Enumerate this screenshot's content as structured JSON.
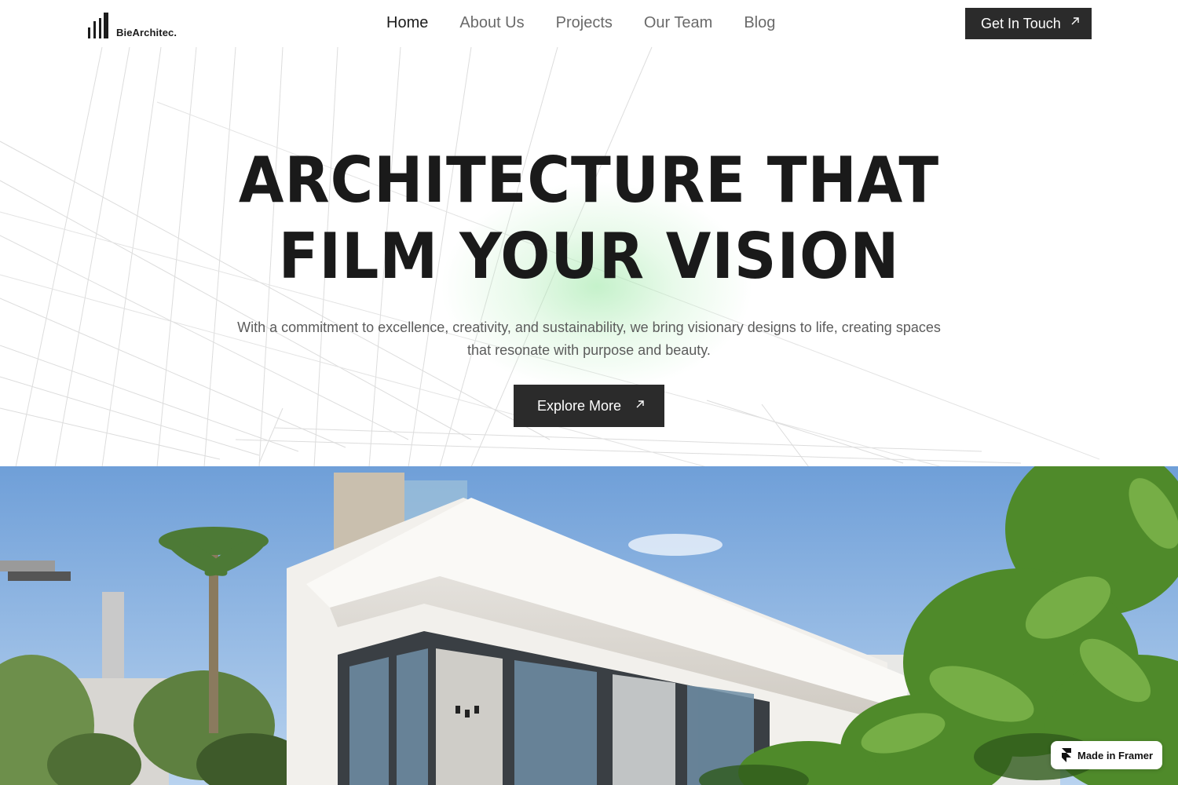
{
  "brand": {
    "name": "BieArchitec."
  },
  "nav": {
    "items": [
      {
        "label": "Home",
        "active": true
      },
      {
        "label": "About Us",
        "active": false
      },
      {
        "label": "Projects",
        "active": false
      },
      {
        "label": "Our Team",
        "active": false
      },
      {
        "label": "Blog",
        "active": false
      }
    ],
    "cta_label": "Get In Touch"
  },
  "hero": {
    "headline_line1": "ARCHITECTURE THAT",
    "headline_line2": "FILM YOUR VISION",
    "subtext": "With a commitment to excellence, creativity, and sustainability, we bring visionary designs to life, creating spaces that resonate with purpose and beauty.",
    "cta_label": "Explore More"
  },
  "badge": {
    "label": "Made in Framer"
  },
  "icons": {
    "logo": "building-bars-icon",
    "cta_arrow": "arrow-up-right-icon",
    "framer": "framer-logo-icon"
  },
  "colors": {
    "text_dark": "#1c1c1c",
    "nav_muted": "#6a6a6a",
    "button_bg": "#2b2b2b",
    "glow": "#a6e8b0"
  }
}
